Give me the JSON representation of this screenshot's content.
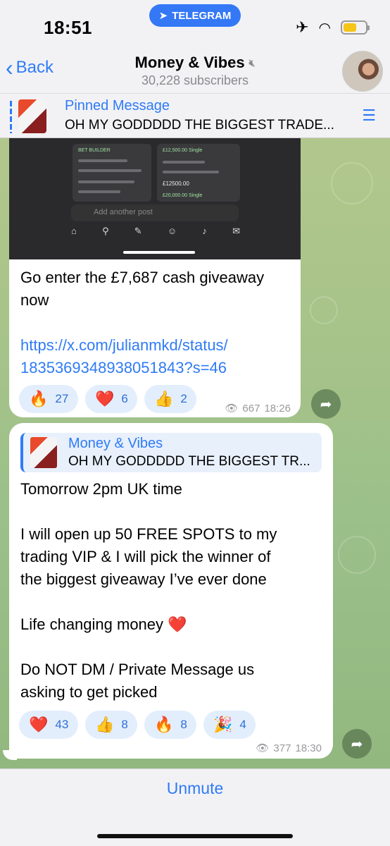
{
  "status_bar": {
    "time": "18:51",
    "app_pill": "TELEGRAM"
  },
  "header": {
    "back_label": "Back",
    "channel_name": "Money & Vibes",
    "subscribers": "30,228 subscribers"
  },
  "pinned": {
    "label": "Pinned Message",
    "text": "OH MY GODDDDD THE BIGGEST TRADE..."
  },
  "message1": {
    "image_texts": {
      "post_placeholder": "Add another post",
      "card1_title": "BET BUILDER",
      "card2_title": "£12,500.00 Single",
      "card2_value": "£12500.00",
      "card3_title": "£20,000.00 Single"
    },
    "text_line1": "Go enter the £7,687 cash giveaway",
    "text_line2": "now",
    "link_line1": "https://x.com/julianmkd/status/",
    "link_line2": "1835369348938051843?s=46",
    "reactions": [
      {
        "emoji": "🔥",
        "count": "27"
      },
      {
        "emoji": "❤️",
        "count": "6"
      },
      {
        "emoji": "👍",
        "count": "2"
      }
    ],
    "views": "667",
    "time": "18:26"
  },
  "message2": {
    "reply_title": "Money & Vibes",
    "reply_text": "OH MY GODDDDD THE BIGGEST TR...",
    "lines": [
      "Tomorrow 2pm UK time",
      "",
      "I will open up 50 FREE SPOTS to my",
      "trading VIP & I will pick the winner of",
      "the biggest giveaway I’ve ever done",
      "",
      "Life changing money ❤️",
      "",
      "Do NOT DM / Private Message us",
      "asking to get picked"
    ],
    "reactions": [
      {
        "emoji": "❤️",
        "count": "43"
      },
      {
        "emoji": "👍",
        "count": "8"
      },
      {
        "emoji": "🔥",
        "count": "8"
      },
      {
        "emoji": "🎉",
        "count": "4"
      }
    ],
    "views": "377",
    "time": "18:30"
  },
  "bottom": {
    "unmute_label": "Unmute"
  },
  "colors": {
    "accent": "#2f7bf6",
    "bar_bg": "#f2f2f5",
    "reaction_bg": "#e3eefc"
  }
}
